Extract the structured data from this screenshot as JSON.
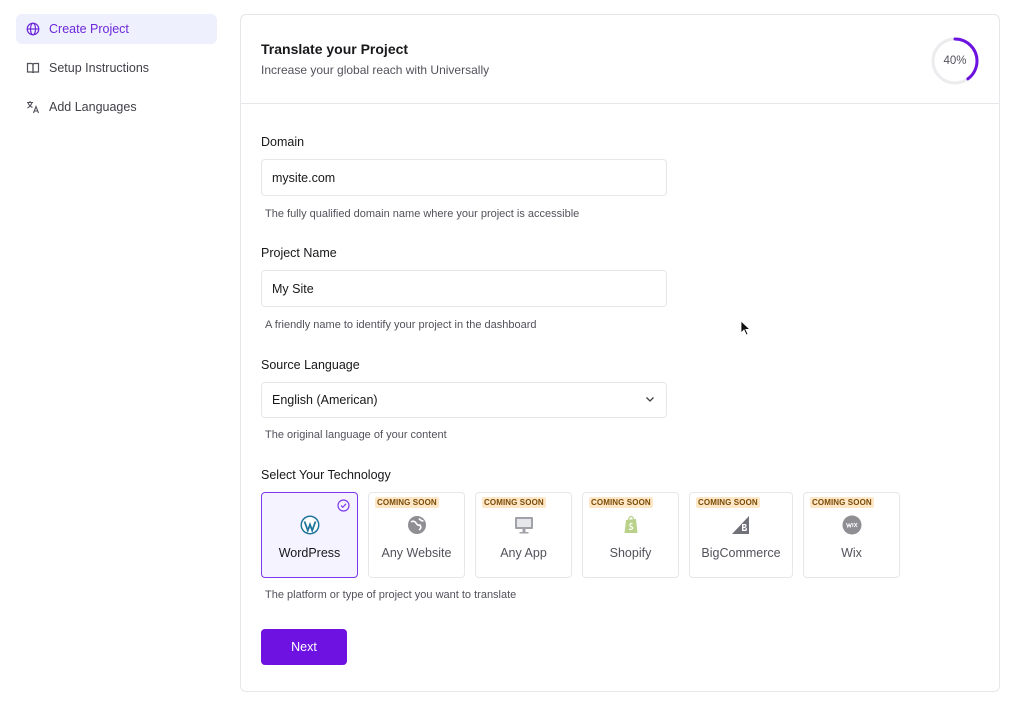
{
  "sidebar": {
    "items": [
      {
        "label": "Create Project",
        "icon": "globe-icon",
        "active": true
      },
      {
        "label": "Setup Instructions",
        "icon": "book-icon",
        "active": false
      },
      {
        "label": "Add Languages",
        "icon": "translate-icon",
        "active": false
      }
    ]
  },
  "header": {
    "title": "Translate your Project",
    "subtitle": "Increase your global reach with Universally",
    "progress_label": "40%",
    "progress_value": 0.4
  },
  "form": {
    "domain": {
      "label": "Domain",
      "value": "mysite.com",
      "help": "The fully qualified domain name where your project is accessible"
    },
    "project_name": {
      "label": "Project Name",
      "value": "My Site",
      "help": "A friendly name to identify your project in the dashboard"
    },
    "source_language": {
      "label": "Source Language",
      "value": "English (American)",
      "help": "The original language of your content"
    },
    "technology": {
      "label": "Select Your Technology",
      "help": "The platform or type of project you want to translate",
      "badge": "COMING SOON",
      "options": [
        {
          "name": "WordPress",
          "icon": "wordpress-icon",
          "selected": true,
          "coming_soon": false
        },
        {
          "name": "Any Website",
          "icon": "globe-icon",
          "selected": false,
          "coming_soon": true
        },
        {
          "name": "Any App",
          "icon": "monitor-icon",
          "selected": false,
          "coming_soon": true
        },
        {
          "name": "Shopify",
          "icon": "shopify-icon",
          "selected": false,
          "coming_soon": true
        },
        {
          "name": "BigCommerce",
          "icon": "bigcommerce-icon",
          "selected": false,
          "coming_soon": true
        },
        {
          "name": "Wix",
          "icon": "wix-icon",
          "selected": false,
          "coming_soon": true
        }
      ]
    },
    "next_label": "Next"
  },
  "colors": {
    "accent": "#6d12e0",
    "active_bg": "#eef0fd",
    "badge_bg": "#fde7c7"
  }
}
